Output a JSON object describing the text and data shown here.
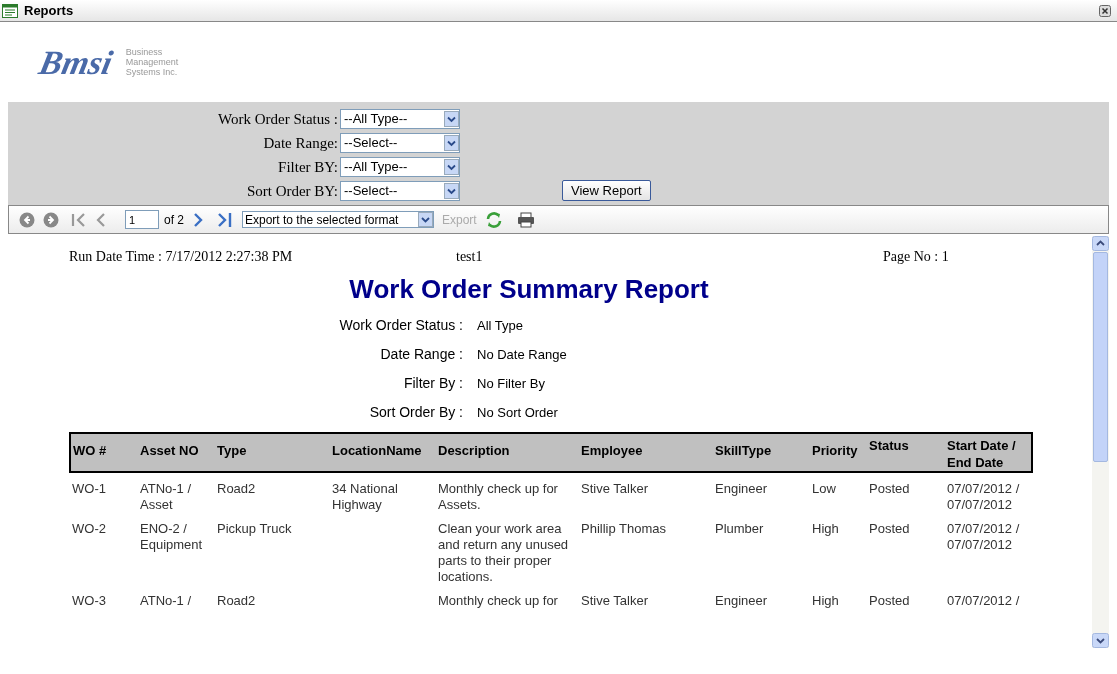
{
  "window": {
    "title": "Reports"
  },
  "logo": {
    "mark": "Bmsi",
    "company": [
      "Business",
      "Management",
      "Systems Inc."
    ]
  },
  "filters": [
    {
      "label": "Work Order Status :",
      "value": "--All Type--"
    },
    {
      "label": "Date Range:",
      "value": "--Select--"
    },
    {
      "label": "Filter BY:",
      "value": "--All Type--"
    },
    {
      "label": "Sort Order BY:",
      "value": "--Select--"
    }
  ],
  "view_button": "View Report",
  "toolbar": {
    "page": "1",
    "of": "of 2",
    "export_format": "Export to the selected format",
    "export": "Export"
  },
  "report": {
    "run_label": "Run Date Time :",
    "run_value": "7/17/2012 2:27:38 PM",
    "user": "test1",
    "page_label": "Page No :",
    "page_value": "1",
    "title": "Work Order Summary Report",
    "criteria": [
      {
        "label": "Work Order Status :",
        "value": "All Type"
      },
      {
        "label": "Date Range :",
        "value": "No Date Range"
      },
      {
        "label": "Filter By :",
        "value": "No Filter By"
      },
      {
        "label": "Sort Order By :",
        "value": "No Sort Order"
      }
    ],
    "columns": [
      "WO #",
      "Asset NO",
      "Type",
      "LocationName",
      "Description",
      "Employee",
      "SkillType",
      "Priority",
      "Status",
      "Start Date / End Date"
    ],
    "rows": [
      [
        "WO-1",
        "ATNo-1 / Asset",
        "Road2",
        "34 National Highway",
        "Monthly check up for Assets.",
        "Stive Talker",
        "Engineer",
        "Low",
        "Posted",
        "07/07/2012 / 07/07/2012"
      ],
      [
        "WO-2",
        "ENO-2 / Equipment",
        "Pickup Truck",
        "",
        "Clean your work area and return any unused parts to their proper locations.",
        "Phillip Thomas",
        "Plumber",
        "High",
        "Posted",
        "07/07/2012 / 07/07/2012"
      ],
      [
        "WO-3",
        "ATNo-1 /",
        "Road2",
        "",
        "Monthly check up for",
        "Stive Talker",
        "Engineer",
        "High",
        "Posted",
        "07/07/2012 /"
      ]
    ]
  }
}
